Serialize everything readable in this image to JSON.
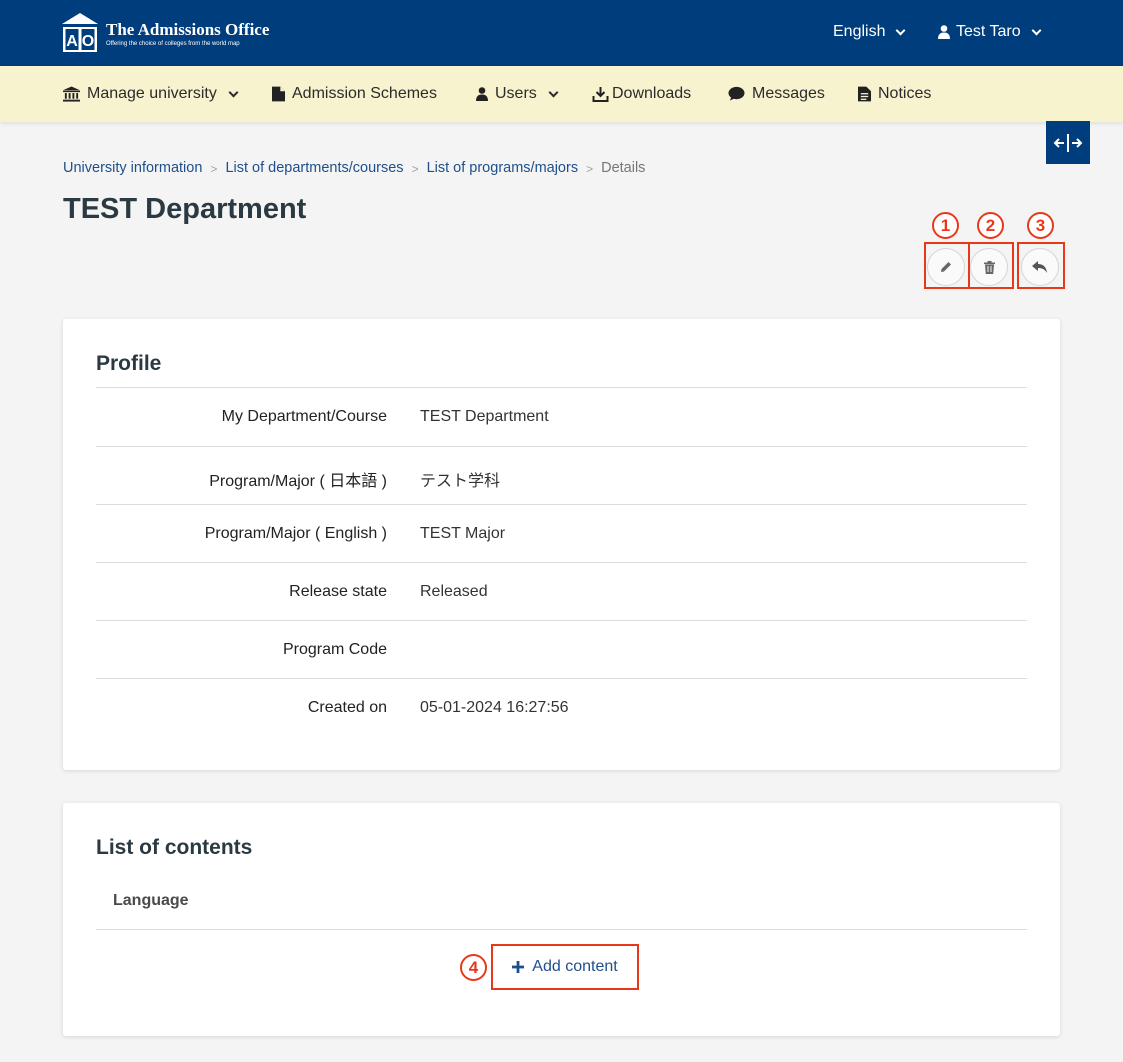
{
  "header": {
    "brand_title": "The Admissions Office",
    "brand_subtitle": "Offering the choice of colleges from the world map",
    "logo_letters": "AO",
    "language": "English",
    "user": "Test Taro",
    "brand_color": "#003d7c"
  },
  "nav": {
    "items": [
      {
        "label": "Manage university",
        "icon": "institution-icon",
        "dropdown": true
      },
      {
        "label": "Admission Schemes",
        "icon": "file-icon",
        "dropdown": false
      },
      {
        "label": "Users",
        "icon": "user-icon",
        "dropdown": true
      },
      {
        "label": "Downloads",
        "icon": "download-icon",
        "dropdown": false
      },
      {
        "label": "Messages",
        "icon": "comment-icon",
        "dropdown": false
      },
      {
        "label": "Notices",
        "icon": "document-icon",
        "dropdown": false
      }
    ],
    "background": "#f8f3cf"
  },
  "breadcrumb": {
    "items": [
      "University information",
      "List of departments/courses",
      "List of programs/majors"
    ],
    "current": "Details",
    "separator": ">"
  },
  "page": {
    "title": "TEST Department"
  },
  "actions": {
    "items": [
      {
        "icon": "pencil-icon",
        "marker": "1"
      },
      {
        "icon": "trash-icon",
        "marker": "2"
      },
      {
        "icon": "reply-icon",
        "marker": "3"
      }
    ],
    "highlight_color": "#e8381b"
  },
  "profile": {
    "title": "Profile",
    "rows": [
      {
        "label": "My Department/Course",
        "value": "TEST Department"
      },
      {
        "label": "Program/Major ( 日本語 )",
        "value": "テスト学科"
      },
      {
        "label": "Program/Major ( English )",
        "value": "TEST Major"
      },
      {
        "label": "Release state",
        "value": "Released"
      },
      {
        "label": "Program Code",
        "value": ""
      },
      {
        "label": "Created on",
        "value": "05-01-2024 16:27:56"
      }
    ]
  },
  "contents": {
    "title": "List of contents",
    "column_language": "Language",
    "add_label": "Add content",
    "add_marker": "4"
  }
}
